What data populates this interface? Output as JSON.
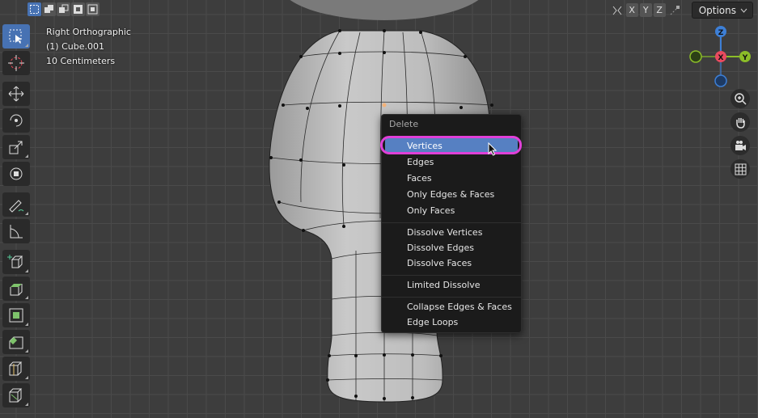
{
  "header": {
    "select_modes": [
      "select-box-icon",
      "extend-icon",
      "subtract-icon",
      "invert-icon",
      "intersect-icon"
    ],
    "axes": [
      "X",
      "Y",
      "Z"
    ],
    "options_label": "Options"
  },
  "overlay": {
    "view_name": "Right Orthographic",
    "object_name": "(1) Cube.001",
    "scale": "10 Centimeters"
  },
  "toolbar": {
    "tools": [
      "select-box-icon",
      "cursor-icon",
      "move-icon",
      "rotate-icon",
      "scale-icon",
      "transform-icon",
      "annotate-icon",
      "measure-icon",
      "add-cube-icon",
      "extrude-icon",
      "inset-icon",
      "bevel-icon",
      "loop-cut-icon",
      "knife-icon"
    ]
  },
  "gizmo": {
    "x_label": "X",
    "y_label": "Y",
    "z_label": "Z",
    "colors": {
      "x": "#e84a5f",
      "y": "#8bbd28",
      "z": "#3d7fd6"
    }
  },
  "menu": {
    "title": "Delete",
    "items": [
      "Vertices",
      "Edges",
      "Faces",
      "Only Edges & Faces",
      "Only Faces",
      "Dissolve Vertices",
      "Dissolve Edges",
      "Dissolve Faces",
      "Limited Dissolve",
      "Collapse Edges & Faces",
      "Edge Loops"
    ],
    "hovered": "Vertices"
  },
  "colors": {
    "accent": "#4772b3",
    "menu_hover": "#5680c2",
    "highlight_ring": "#e040d8"
  }
}
